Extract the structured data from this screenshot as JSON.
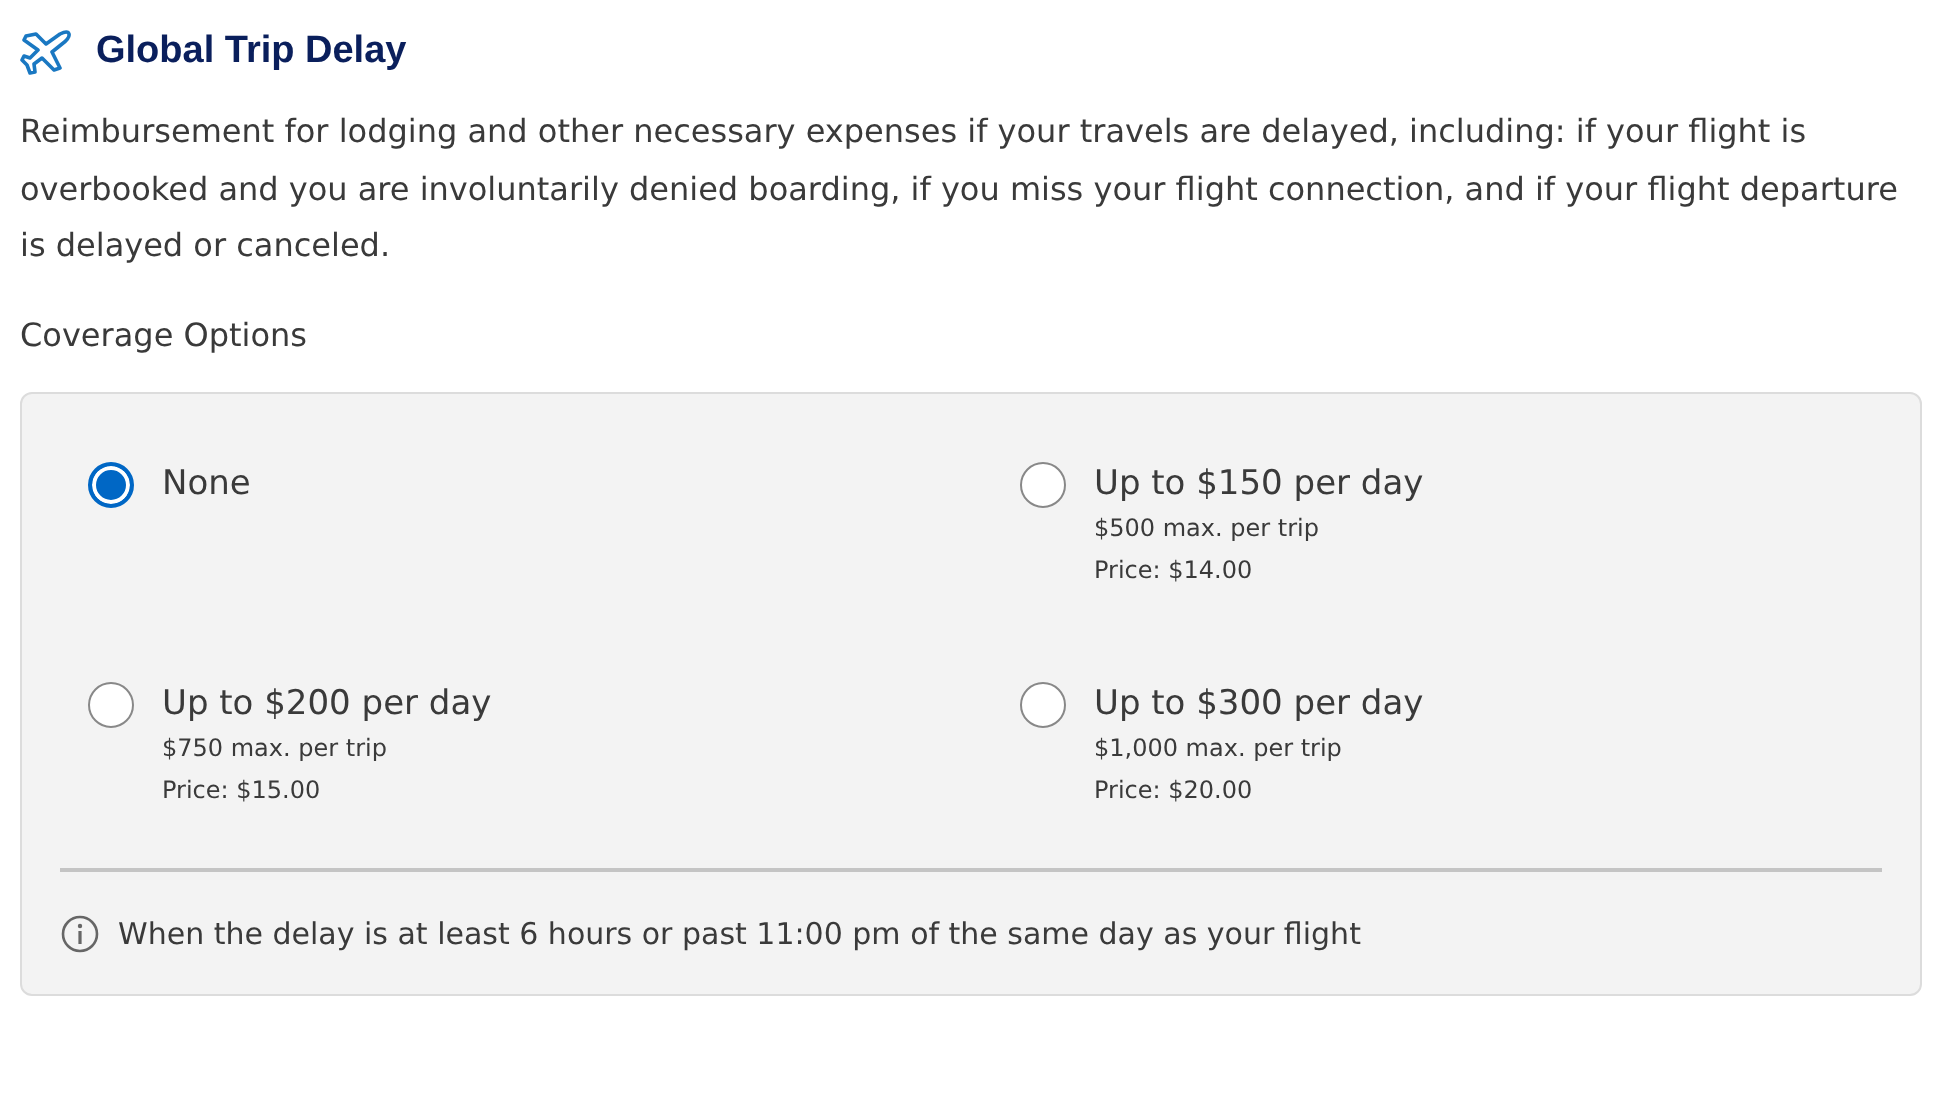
{
  "heading": "Global Trip Delay",
  "description": "Reimbursement for lodging and other necessary expenses if your travels are delayed, including: if your flight is overbooked and you are involuntarily denied boarding, if you miss your flight connection, and if your flight departure is delayed or canceled.",
  "coverage_label": "Coverage Options",
  "options": [
    {
      "title": "None",
      "selected": true
    },
    {
      "title": "Up to $150 per day",
      "max": "$500 max. per trip",
      "price": "Price: $14.00",
      "selected": false
    },
    {
      "title": "Up to $200 per day",
      "max": "$750 max. per trip",
      "price": "Price: $15.00",
      "selected": false
    },
    {
      "title": "Up to $300 per day",
      "max": "$1,000 max. per trip",
      "price": "Price: $20.00",
      "selected": false
    }
  ],
  "note": "When the delay is at least 6 hours or past 11:00 pm of the same day as your flight"
}
